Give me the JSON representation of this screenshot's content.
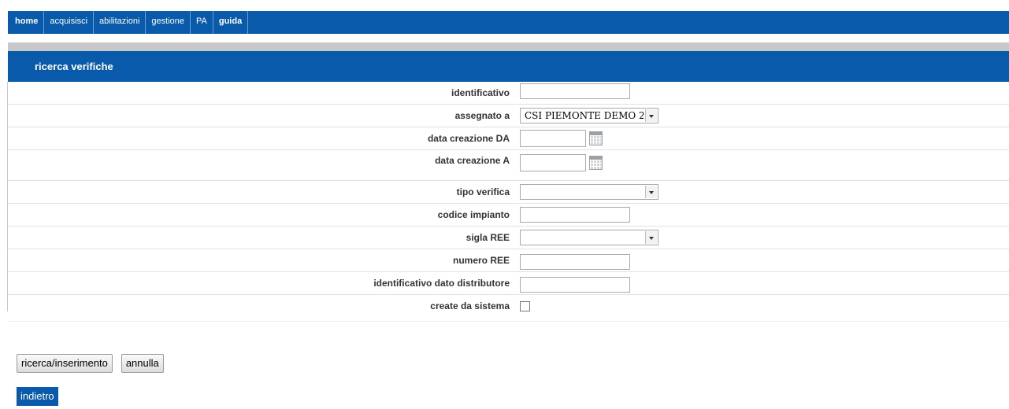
{
  "nav": {
    "items": [
      {
        "label": "home"
      },
      {
        "label": "acquisisci"
      },
      {
        "label": "abilitazioni"
      },
      {
        "label": "gestione"
      },
      {
        "label": "PA"
      },
      {
        "label": "guida"
      }
    ]
  },
  "section": {
    "title": "ricerca verifiche"
  },
  "form": {
    "identificativo": {
      "label": "identificativo",
      "value": ""
    },
    "assegnato_a": {
      "label": "assegnato a",
      "value": "CSI PIEMONTE DEMO 2"
    },
    "data_creazione_da": {
      "label": "data creazione DA",
      "value": ""
    },
    "data_creazione_a": {
      "label": "data creazione A",
      "value": ""
    },
    "tipo_verifica": {
      "label": "tipo verifica",
      "value": ""
    },
    "codice_impianto": {
      "label": "codice impianto",
      "value": ""
    },
    "sigla_ree": {
      "label": "sigla REE",
      "value": ""
    },
    "numero_ree": {
      "label": "numero REE",
      "value": ""
    },
    "identificativo_dato_distributore": {
      "label": "identificativo dato distributore",
      "value": ""
    },
    "create_da_sistema": {
      "label": "create da sistema",
      "checked": false
    }
  },
  "buttons": {
    "search": "ricerca/inserimento",
    "cancel": "annulla",
    "back": "indietro"
  },
  "icons": {
    "calendar": "calendar-icon",
    "dropdown": "chevron-down-icon"
  },
  "colors": {
    "brand_blue": "#0a5aab",
    "grey_band": "#c8c8c8"
  }
}
